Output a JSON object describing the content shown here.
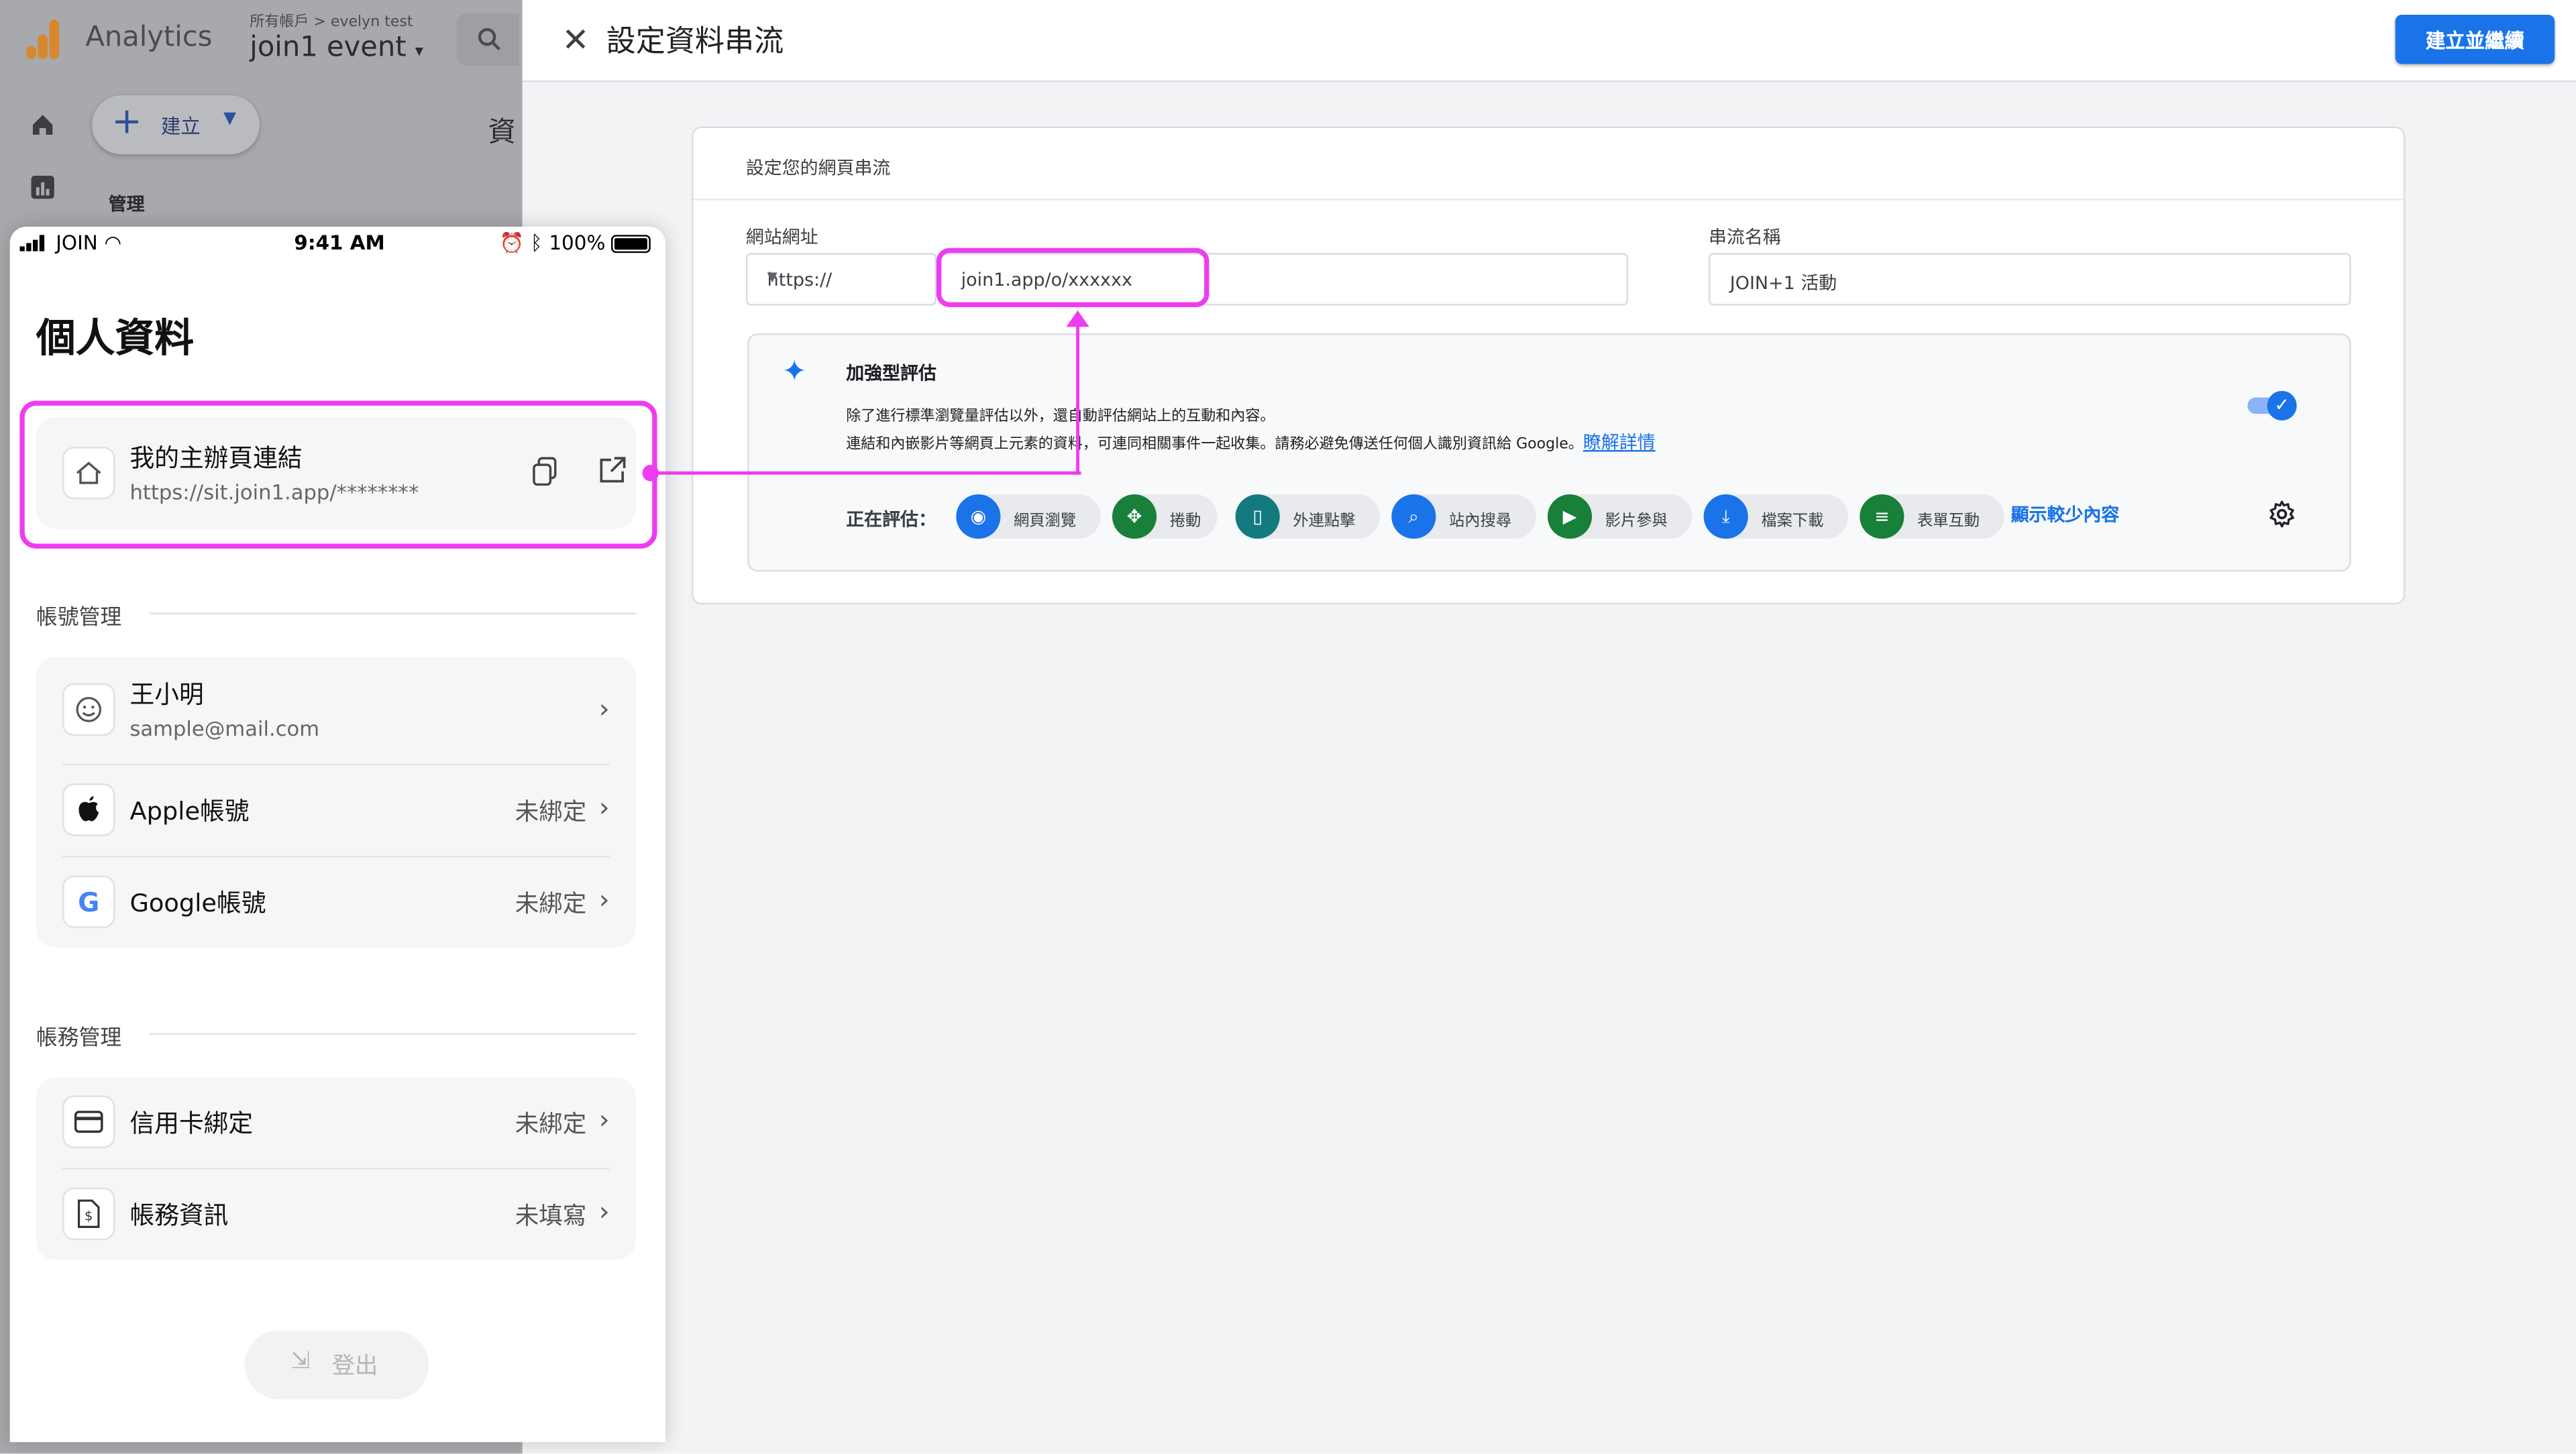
{
  "ga": {
    "product": "Analytics",
    "breadcrumb": "所有帳戶 > evelyn test",
    "property": "join1 event",
    "property_caret": "▾",
    "create": "建立",
    "admin": "管理",
    "partial_heading": "資"
  },
  "panel": {
    "title": "設定資料串流",
    "primary_button": "建立並繼續",
    "section_title": "設定您的網頁串流",
    "url_label": "網站網址",
    "protocol": "https://",
    "url_value": "join1.app/o/xxxxxx",
    "stream_label": "串流名稱",
    "stream_value": "JOIN+1 活動",
    "enhanced": {
      "title": "加強型評估",
      "desc1": "除了進行標準瀏覽量評估以外，還自動評估網站上的互動和內容。",
      "desc2": "連結和內嵌影片等網頁上元素的資料，可連同相關事件一起收集。請務必避免傳送任何個人識別資訊給 Google。",
      "learn_more": "瞭解詳情",
      "measuring_label": "正在評估：",
      "chips": [
        {
          "label": "網頁瀏覽",
          "icon": "eye-icon",
          "color": "#1a73e8"
        },
        {
          "label": "捲動",
          "icon": "scroll-icon",
          "color": "#188038"
        },
        {
          "label": "外連點擊",
          "icon": "mouse-icon",
          "color": "#137a7f"
        },
        {
          "label": "站內搜尋",
          "icon": "search-icon",
          "color": "#1a73e8"
        },
        {
          "label": "影片參與",
          "icon": "play-icon",
          "color": "#188038"
        },
        {
          "label": "檔案下載",
          "icon": "download-icon",
          "color": "#1a73e8"
        },
        {
          "label": "表單互動",
          "icon": "form-icon",
          "color": "#188038"
        }
      ],
      "show_less": "顯示較少內容"
    }
  },
  "phone": {
    "status": {
      "carrier": "JOIN",
      "time": "9:41 AM",
      "battery": "100%"
    },
    "title": "個人資料",
    "host_link": {
      "title": "我的主辦頁連結",
      "url": "https://sit.join1.app/********"
    },
    "account_section": "帳號管理",
    "user": {
      "name": "王小明",
      "email": "sample@mail.com"
    },
    "apple": {
      "label": "Apple帳號",
      "value": "未綁定"
    },
    "google": {
      "label": "Google帳號",
      "value": "未綁定"
    },
    "billing_section": "帳務管理",
    "card": {
      "label": "信用卡綁定",
      "value": "未綁定"
    },
    "billing": {
      "label": "帳務資訊",
      "value": "未填寫"
    },
    "logout": "登出"
  },
  "colors": {
    "highlight": "#ee3cf0",
    "primary": "#1a73e8"
  }
}
